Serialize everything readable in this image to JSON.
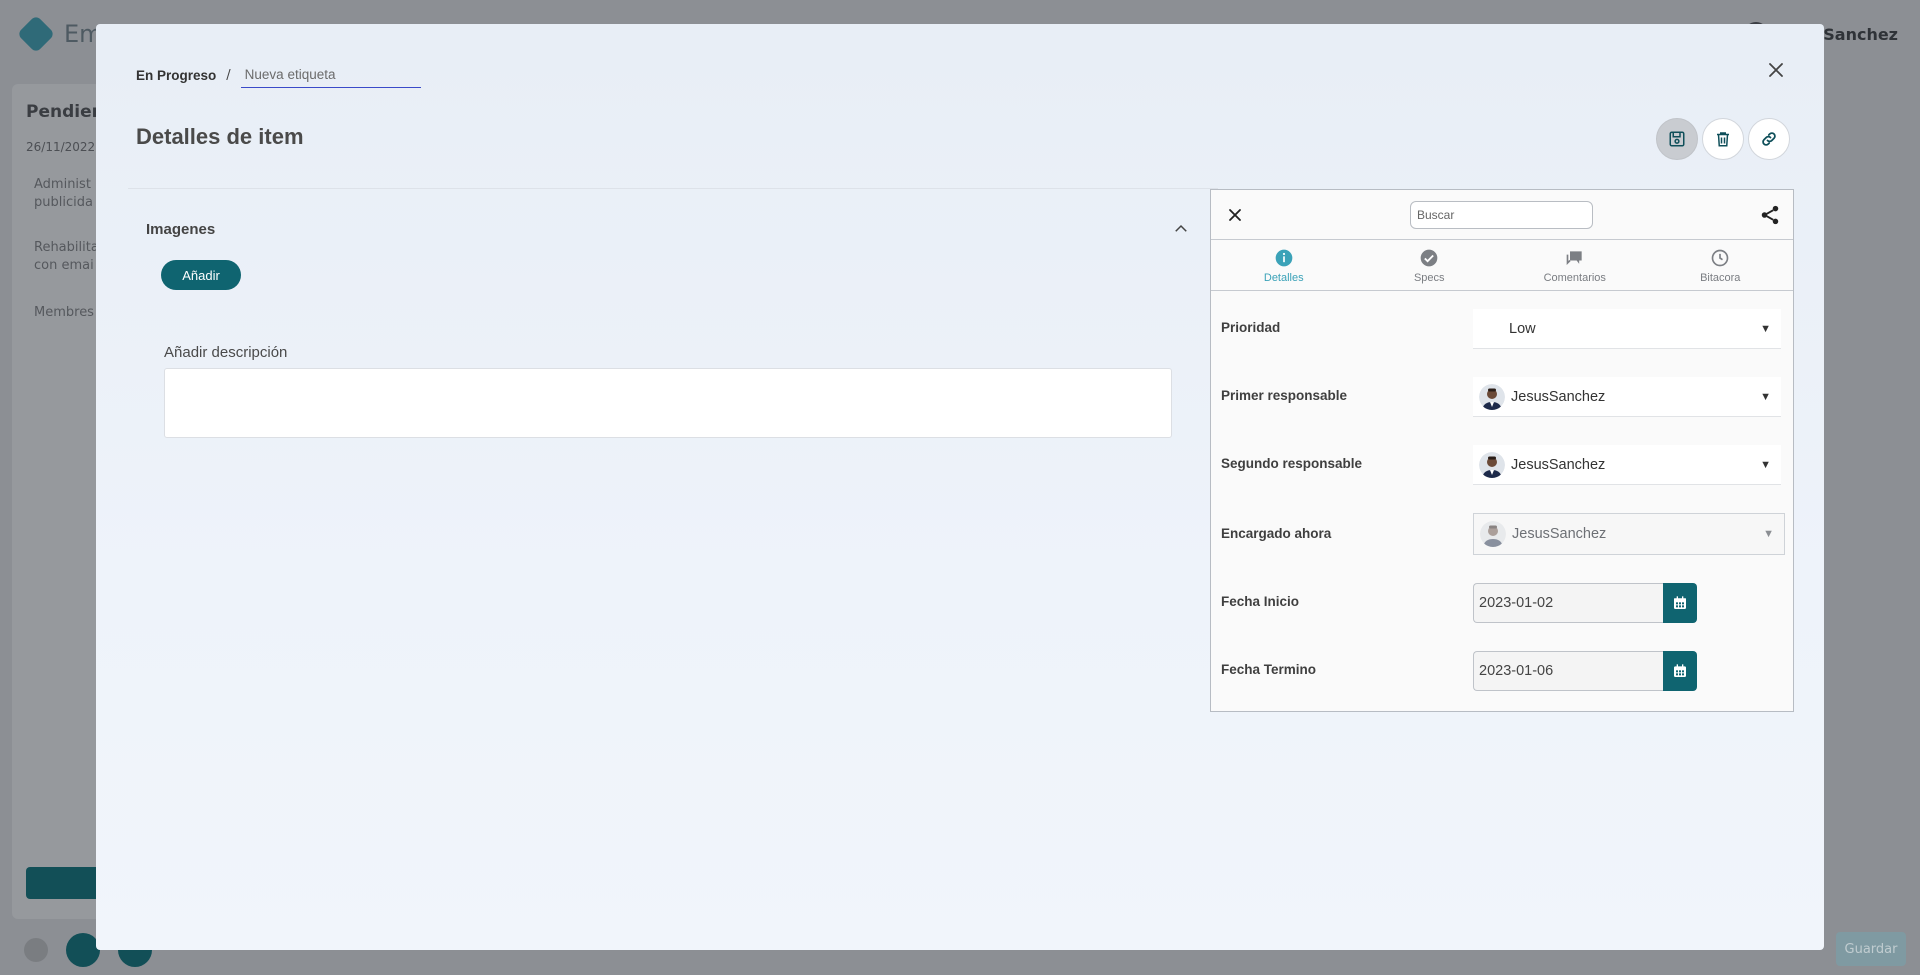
{
  "background": {
    "app_name": "Em",
    "user_name": "JesusSanchez",
    "card_title": "Pendien",
    "card_date": "26/11/2022",
    "card_lines": [
      "Administ",
      "publicida",
      "Rehabilita",
      "con emai",
      "Membres"
    ],
    "bottom_button": "Guardar"
  },
  "modal": {
    "breadcrumb": {
      "status": "En Progreso",
      "separator": "/",
      "tag_placeholder": "Nueva etiqueta"
    },
    "title": "Detalles de item",
    "actions": [
      "save-icon",
      "trash-icon",
      "link-icon"
    ],
    "images_section": {
      "title": "Imagenes",
      "add_label": "Añadir"
    },
    "description": {
      "label": "Añadir descripción",
      "value": ""
    },
    "panel": {
      "search_placeholder": "Buscar",
      "tabs": [
        {
          "label": "Detalles",
          "icon": "info-icon",
          "selected": true
        },
        {
          "label": "Specs",
          "icon": "check-circle-icon",
          "selected": false
        },
        {
          "label": "Comentarios",
          "icon": "comments-icon",
          "selected": false
        },
        {
          "label": "Bitacora",
          "icon": "clock-icon",
          "selected": false
        }
      ],
      "fields": {
        "prioridad": {
          "label": "Prioridad",
          "value": "Low"
        },
        "primer": {
          "label": "Primer responsable",
          "value": "JesusSanchez"
        },
        "segundo": {
          "label": "Segundo responsable",
          "value": "JesusSanchez"
        },
        "encargado": {
          "label": "Encargado ahora",
          "value": "JesusSanchez"
        },
        "inicio": {
          "label": "Fecha Inicio",
          "value": "2023-01-02"
        },
        "termino": {
          "label": "Fecha Termino",
          "value": "2023-01-06"
        }
      }
    }
  },
  "colors": {
    "accent": "#0f6470",
    "tab_selected": "#3ba2b8",
    "tag_underline": "#3a4ac9"
  }
}
